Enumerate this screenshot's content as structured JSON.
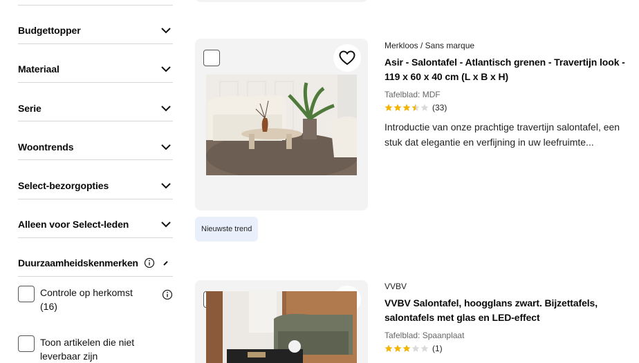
{
  "filters": {
    "items": [
      {
        "label": "Budgettopper"
      },
      {
        "label": "Materiaal"
      },
      {
        "label": "Serie"
      },
      {
        "label": "Woontrends"
      },
      {
        "label": "Select-bezorgopties"
      },
      {
        "label": "Alleen voor Select-leden"
      }
    ],
    "sustainability": {
      "label": "Duurzaamheidskenmerken",
      "options": [
        {
          "label": "Controle op herkomst (16)"
        },
        {
          "label": "Toon artikelen die niet leverbaar zijn"
        }
      ]
    }
  },
  "products": [
    {
      "brand": "Merkloos / Sans marque",
      "title": "Asir - Salontafel - Atlantisch grenen - Travertijn look - 119 x 60 x 40 cm (L x B x H)",
      "spec": "Tafelblad: MDF",
      "rating": 3.5,
      "review_count": "(33)",
      "description": "Introductie van onze prachtige travertijn salontafel, een stuk dat elegantie en verfijning in uw leefruimte...",
      "badge": "Nieuwste trend"
    },
    {
      "brand": "VVBV",
      "title": "VVBV Salontafel, hoogglans zwart. Bijzettafels, salontafels met glas en LED-effect",
      "spec": "Tafelblad: Spaanplaat",
      "rating": 3,
      "review_count": "(1)"
    }
  ],
  "colors": {
    "star": "#f5b400",
    "star_empty": "#d9d9d9",
    "badge_bg": "#eaf0fb",
    "card_bg": "#f3f3f3"
  },
  "icons": [
    "chevron-down-icon",
    "info-icon",
    "collapse-icon",
    "heart-icon",
    "star-icon"
  ]
}
